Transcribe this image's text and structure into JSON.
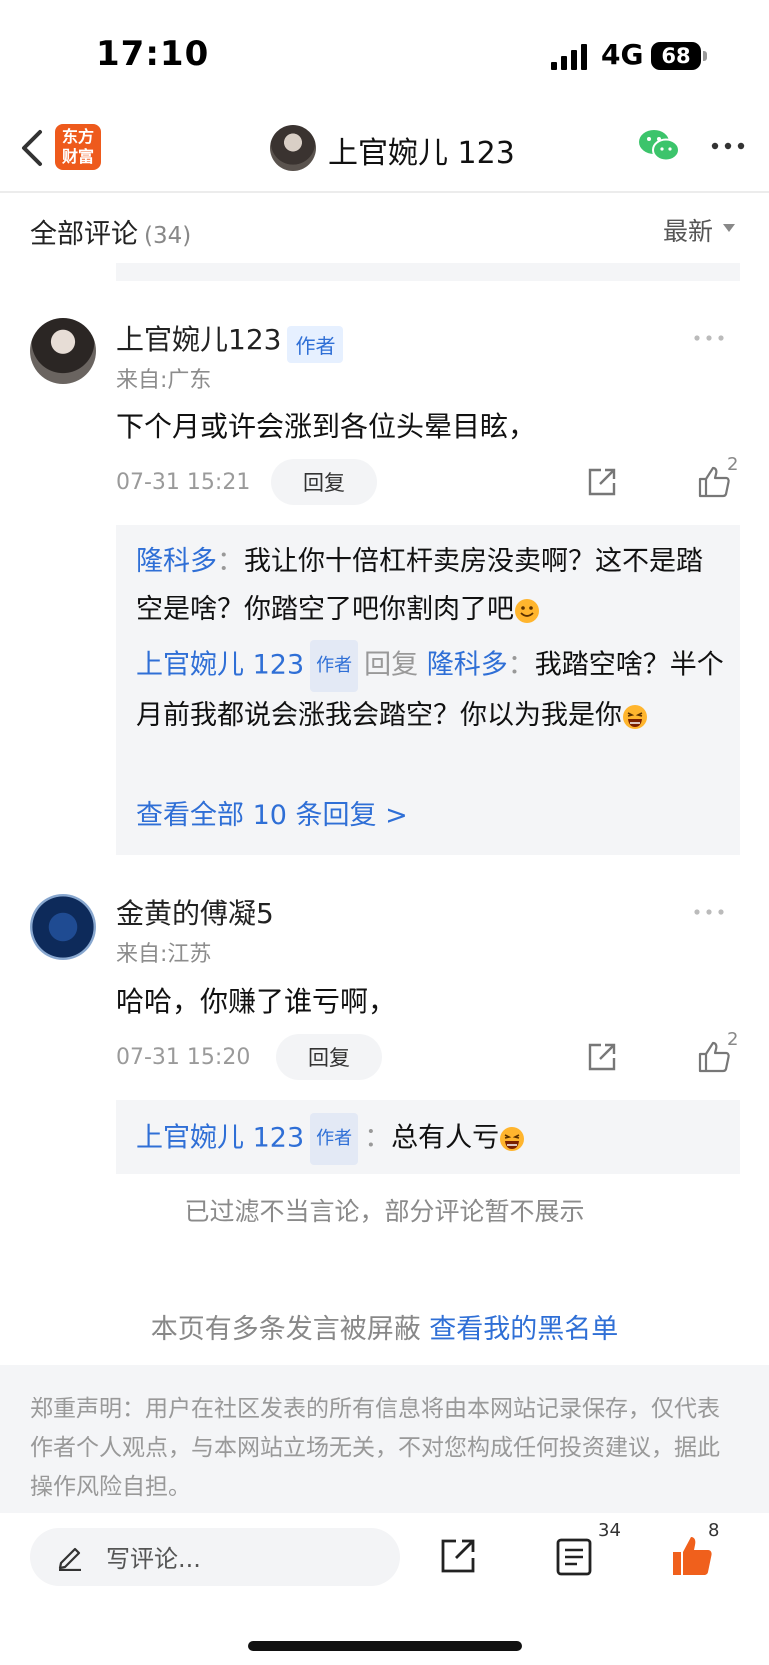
{
  "status": {
    "time": "17:10",
    "network": "4G",
    "battery": "68"
  },
  "nav": {
    "logo_line1": "东方",
    "logo_line2": "财富",
    "title": "上官婉儿 123"
  },
  "section": {
    "title": "全部评论",
    "count": "(34)",
    "sort": "最新"
  },
  "comments": [
    {
      "author": "上官婉儿123",
      "badge": "作者",
      "from": "来自:广东",
      "text": "下个月或许会涨到各位头晕目眩，",
      "time": "07-31 15:21",
      "reply_label": "回复",
      "likes": "2",
      "replies": [
        {
          "user": "隆科多",
          "sep": "：",
          "text": "我让你十倍杠杆卖房没卖啊？这不是踏空是啥？你踏空了吧你割肉了吧",
          "emoji": "smile-emoji"
        },
        {
          "user": "上官婉儿 123",
          "badge": "作者",
          "action": "回复",
          "target": "隆科多",
          "sep": "：",
          "text": "我踏空啥？半个月前我都说会涨我会踏空？你以为我是你",
          "emoji": "laugh-emoji"
        }
      ],
      "more_replies": "查看全部 10 条回复 >"
    },
    {
      "author": "金黄的傅凝5",
      "from": "来自:江苏",
      "text": "哈哈，你赚了谁亏啊，",
      "time": "07-31 15:20",
      "reply_label": "回复",
      "likes": "2",
      "replies": [
        {
          "user": "上官婉儿 123",
          "badge": "作者",
          "sep": "：",
          "text": "总有人亏",
          "emoji": "laugh-emoji"
        }
      ]
    }
  ],
  "notice": {
    "filtered": "已过滤不当言论，部分评论暂不展示",
    "blocked_prefix": "本页有多条发言被屏蔽 ",
    "blocked_link": "查看我的黑名单",
    "disclaimer": "郑重声明：用户在社区发表的所有信息将由本网站记录保存，仅代表作者个人观点，与本网站立场无关，不对您构成任何投资建议，据此操作风险自担。"
  },
  "bottom": {
    "placeholder": "写评论...",
    "comment_count": "34",
    "like_count": "8"
  },
  "colors": {
    "accent": "#2f6fd6",
    "like": "#f0601c",
    "logo": "#ee5a1c"
  }
}
